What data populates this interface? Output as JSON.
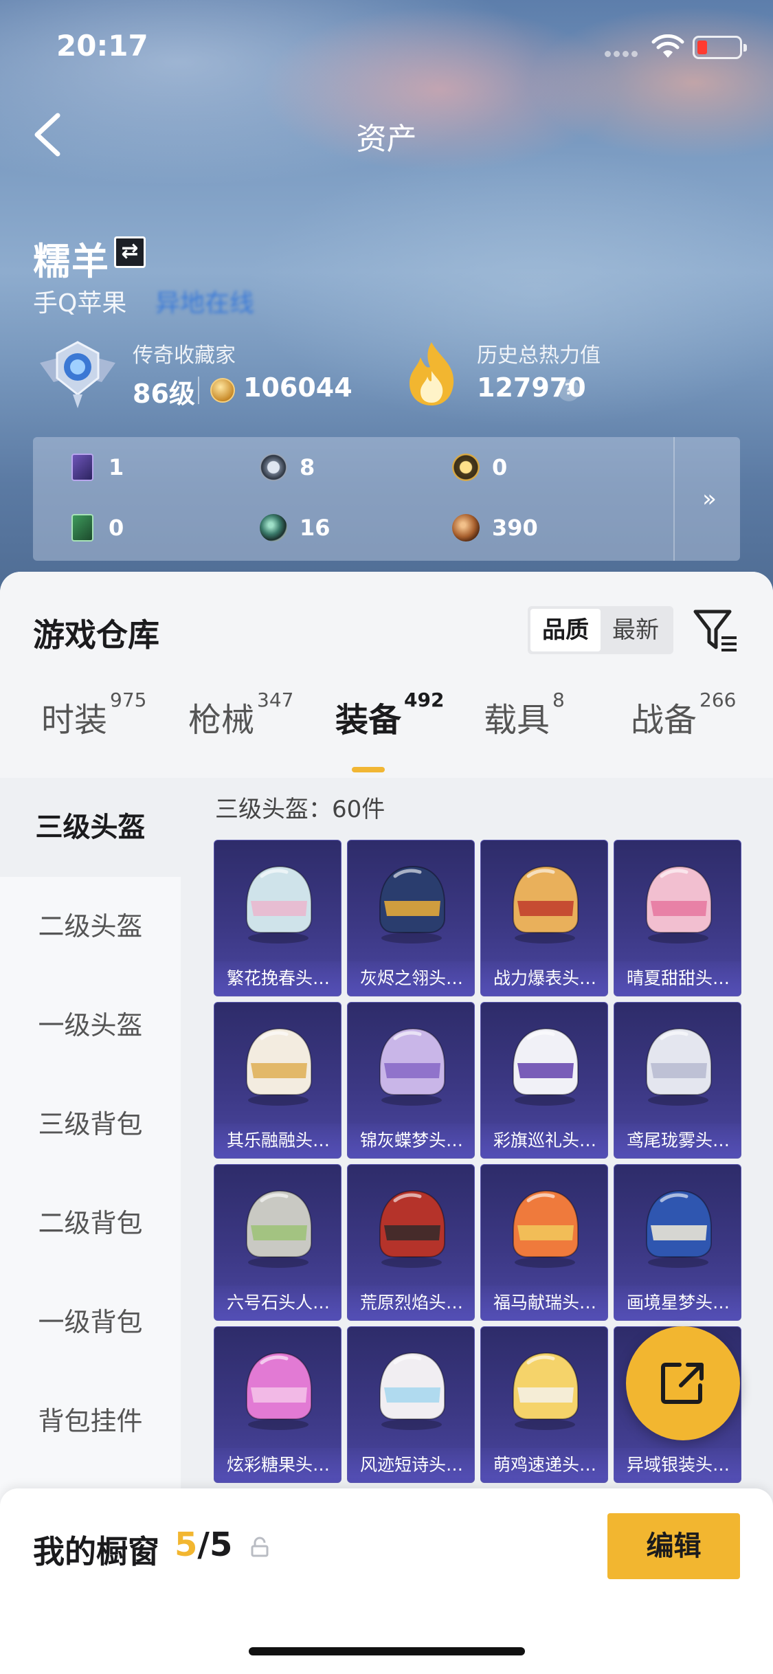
{
  "status": {
    "time": "20:17"
  },
  "nav": {
    "title": "资产"
  },
  "profile": {
    "name": "糯羊",
    "platform": "手Q苹果",
    "online_status": "异地在线",
    "level_title": "传奇收藏家",
    "level": "86级",
    "points": "106044",
    "heat_title": "历史总热力值",
    "heat_value": "127970",
    "help": "?"
  },
  "assets": [
    {
      "icon": "purple-card-icon",
      "value": "1"
    },
    {
      "icon": "silver-medal-icon",
      "value": "8"
    },
    {
      "icon": "gold-medal-icon",
      "value": "0"
    },
    {
      "icon": "green-card-icon",
      "value": "0"
    },
    {
      "icon": "teal-orb-icon",
      "value": "16"
    },
    {
      "icon": "bronze-coin-icon",
      "value": "390"
    }
  ],
  "assets_more": "»",
  "warehouse": {
    "title": "游戏仓库",
    "sort_options": [
      "品质",
      "最新"
    ],
    "sort_selected": "品质"
  },
  "tabs": [
    {
      "label": "时装",
      "count": "975"
    },
    {
      "label": "枪械",
      "count": "347"
    },
    {
      "label": "装备",
      "count": "492",
      "active": true
    },
    {
      "label": "载具",
      "count": "8"
    },
    {
      "label": "战备",
      "count": "266"
    }
  ],
  "sidebar": [
    {
      "label": "三级头盔",
      "active": true
    },
    {
      "label": "二级头盔"
    },
    {
      "label": "一级头盔"
    },
    {
      "label": "三级背包"
    },
    {
      "label": "二级背包"
    },
    {
      "label": "一级背包"
    },
    {
      "label": "背包挂件"
    }
  ],
  "category_count": "三级头盔：60件",
  "items": [
    {
      "name": "繁花挽春头…",
      "color": "#cfe3ea",
      "accent": "#e9b8cf"
    },
    {
      "name": "灰烬之翎头…",
      "color": "#2a3d6e",
      "accent": "#e1a73a"
    },
    {
      "name": "战力爆表头…",
      "color": "#e9b05b",
      "accent": "#c2412e"
    },
    {
      "name": "晴夏甜甜头…",
      "color": "#f2bfd0",
      "accent": "#e77aa1"
    },
    {
      "name": "其乐融融头…",
      "color": "#f3ece0",
      "accent": "#e0b35c"
    },
    {
      "name": "锦灰蝶梦头…",
      "color": "#c9b6e8",
      "accent": "#8a6cc8"
    },
    {
      "name": "彩旗巡礼头…",
      "color": "#f1f1f7",
      "accent": "#6b4db0"
    },
    {
      "name": "鸢尾珑雾头…",
      "color": "#e4e6ef",
      "accent": "#b9bdd2"
    },
    {
      "name": "六号石头人…",
      "color": "#c9c9c3",
      "accent": "#9ec27a"
    },
    {
      "name": "荒原烈焰头…",
      "color": "#b5332a",
      "accent": "#3a2a2a"
    },
    {
      "name": "福马献瑞头…",
      "color": "#ef7a3c",
      "accent": "#f2c45a"
    },
    {
      "name": "画境星梦头…",
      "color": "#2f56b0",
      "accent": "#e9e4d6"
    },
    {
      "name": "炫彩糖果头…",
      "color": "#e27ad4",
      "accent": "#f4c0e8"
    },
    {
      "name": "风迹短诗头…",
      "color": "#f1eef2",
      "accent": "#a9d7ee"
    },
    {
      "name": "萌鸡速递头…",
      "color": "#f5d36a",
      "accent": "#f5f0e2"
    },
    {
      "name": "异域银装头…",
      "color": "#d7d9e3",
      "accent": "#9aa0bb"
    }
  ],
  "showcase": {
    "title": "我的橱窗",
    "current": "5",
    "total": "/5",
    "edit_label": "编辑"
  },
  "colors": {
    "accent": "#f2b630",
    "online": "#3a7ad8",
    "card_bg": "#3c3884"
  }
}
